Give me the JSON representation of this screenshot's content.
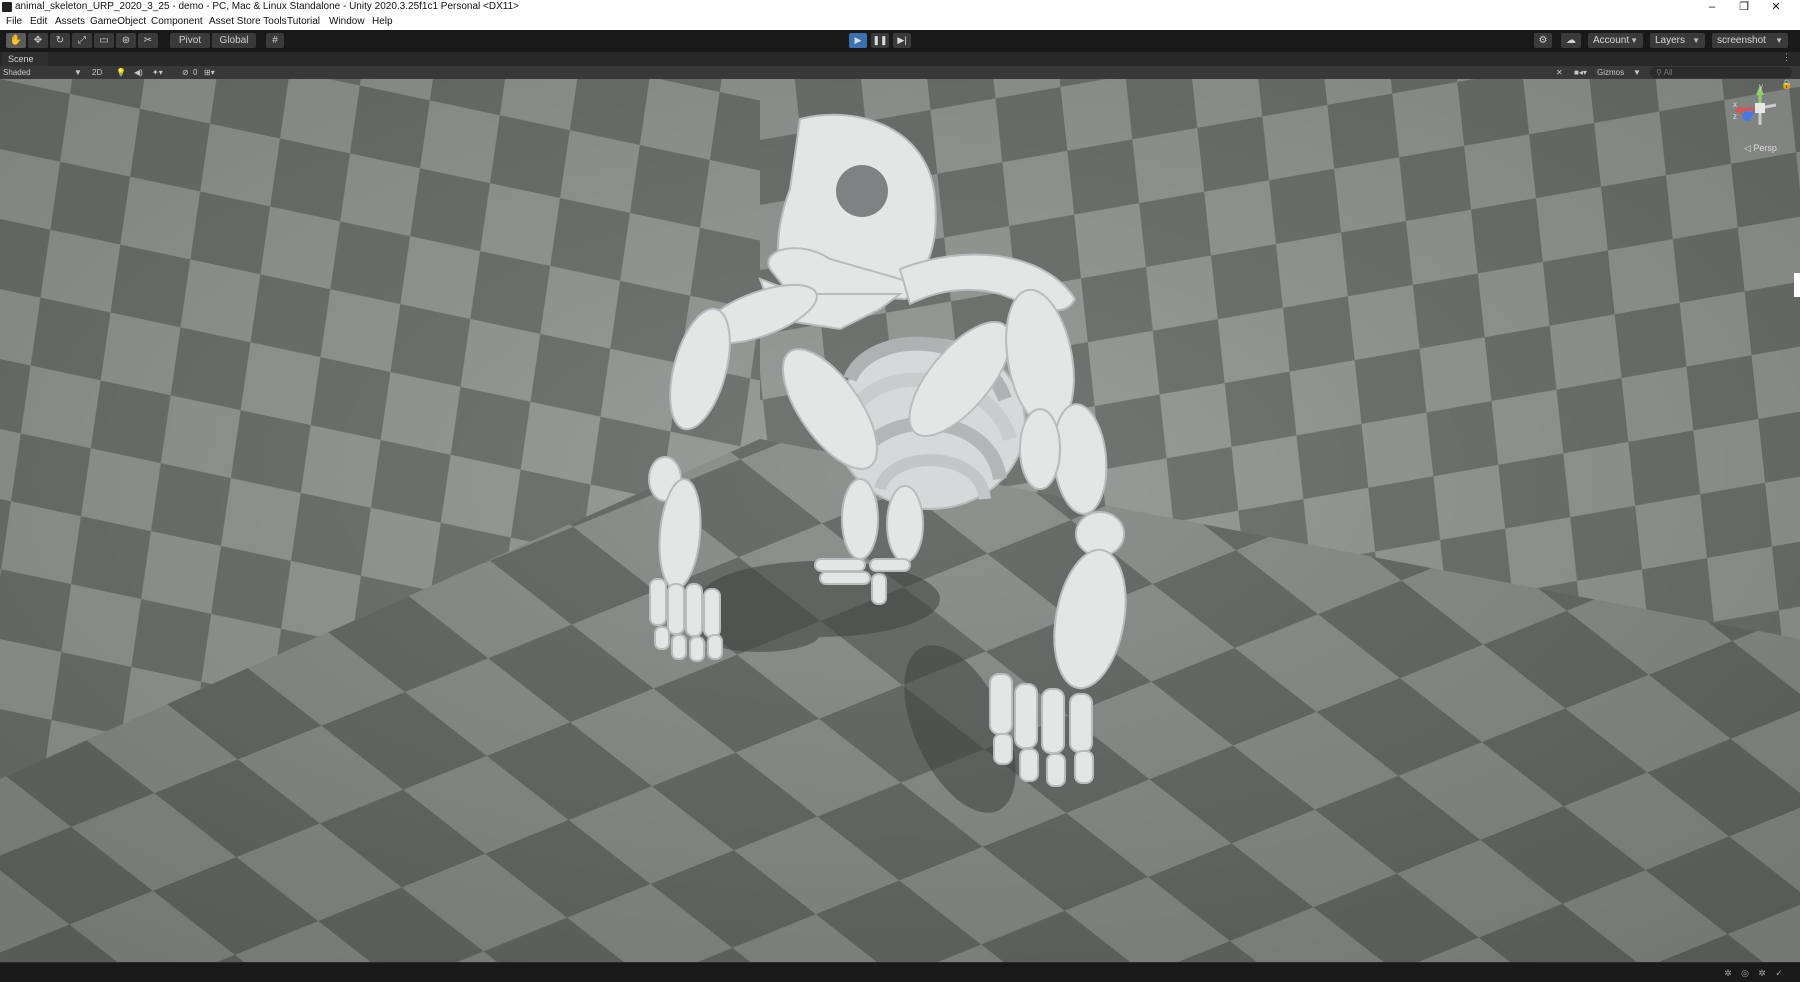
{
  "window": {
    "title": "animal_skeleton_URP_2020_3_25 - demo - PC, Mac & Linux Standalone - Unity 2020.3.25f1c1 Personal <DX11>",
    "minimize_glyph": "–",
    "maximize_glyph": "❐",
    "close_glyph": "✕"
  },
  "menu": [
    "File",
    "Edit",
    "Assets",
    "GameObject",
    "Component",
    "Asset Store Tools",
    "Tutorial",
    "Window",
    "Help"
  ],
  "toolbar": {
    "tools": [
      "hand-tool-icon",
      "move-tool-icon",
      "rotate-tool-icon",
      "scale-tool-icon",
      "rect-tool-icon",
      "transform-tool-icon",
      "custom-tool-icon"
    ],
    "pivot_label": "Pivot",
    "global_label": "Global",
    "play_glyph": "▶",
    "pause_glyph": "❚❚",
    "step_glyph": "▶|",
    "account_label": "Account",
    "layers_label": "Layers",
    "layout_label": "screenshot"
  },
  "scene": {
    "tab_label": "Scene",
    "shading_mode": "Shaded",
    "mode_2d": "2D",
    "hidden_count": "0",
    "gizmos_label": "Gizmos",
    "search_placeholder": "All",
    "persp_label": "◁ Persp",
    "axis_y": "y",
    "axis_x": "x",
    "axis_z": "z"
  },
  "colors": {
    "play_active": "#3a72b0",
    "checker_light": "#9a9d9a",
    "checker_dark": "#737673",
    "bone": "#e4e6e6"
  }
}
